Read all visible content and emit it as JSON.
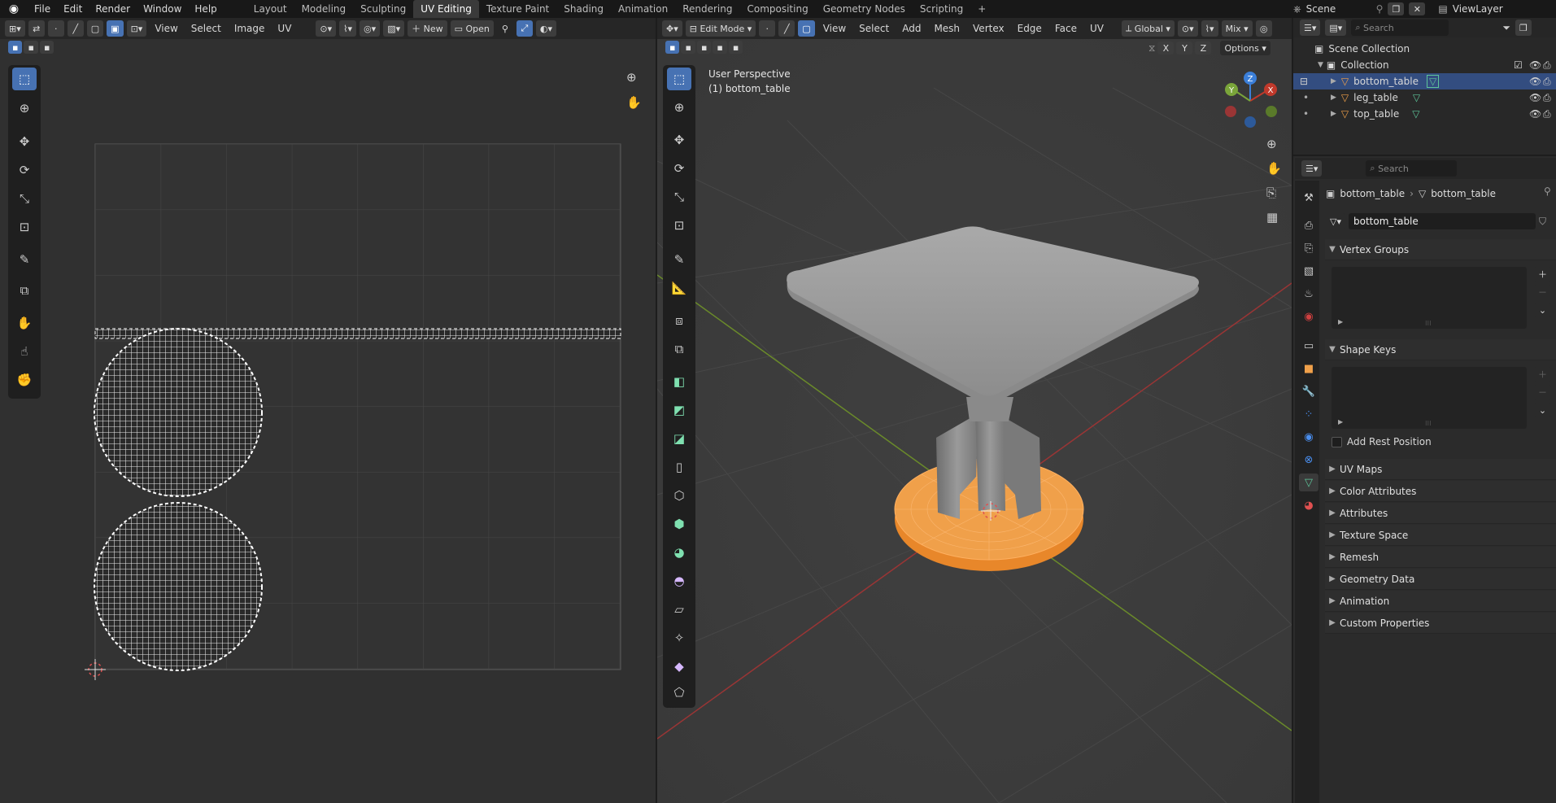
{
  "topbar": {
    "menus": [
      "File",
      "Edit",
      "Render",
      "Window",
      "Help"
    ],
    "workspaces": [
      "Layout",
      "Modeling",
      "Sculpting",
      "UV Editing",
      "Texture Paint",
      "Shading",
      "Animation",
      "Rendering",
      "Compositing",
      "Geometry Nodes",
      "Scripting"
    ],
    "active_workspace": "UV Editing",
    "add": "+",
    "scene": "Scene",
    "view_layer": "ViewLayer"
  },
  "uv_editor": {
    "menus": [
      "View",
      "Select",
      "Image",
      "UV"
    ],
    "new": "New",
    "open": "Open"
  },
  "viewport": {
    "mode": "Edit Mode",
    "menus": [
      "View",
      "Select",
      "Add",
      "Mesh",
      "Vertex",
      "Edge",
      "Face",
      "UV"
    ],
    "orientation": "Global",
    "mix": "Mix",
    "axes": [
      "X",
      "Y",
      "Z"
    ],
    "options": "Options",
    "overlay_line1": "User Perspective",
    "overlay_line2": "(1) bottom_table",
    "gizmo": {
      "x": "X",
      "y": "Y",
      "z": "Z"
    }
  },
  "outliner": {
    "search_placeholder": "Search",
    "scene_collection": "Scene Collection",
    "collection": "Collection",
    "objects": [
      "bottom_table",
      "leg_table",
      "top_table"
    ]
  },
  "properties": {
    "search_placeholder": "Search",
    "breadcrumb_object": "bottom_table",
    "breadcrumb_mesh": "bottom_table",
    "mesh_name": "bottom_table",
    "vertex_groups": "Vertex Groups",
    "shape_keys": "Shape Keys",
    "add_rest_position": "Add Rest Position",
    "sections": [
      "UV Maps",
      "Color Attributes",
      "Attributes",
      "Texture Space",
      "Remesh",
      "Geometry Data",
      "Animation",
      "Custom Properties"
    ]
  },
  "colors": {
    "accent": "#4772b3",
    "selection": "#ff9a2e",
    "x_axis": "#c0392b",
    "y_axis": "#7aa53a",
    "z_axis": "#3b7fd9"
  }
}
